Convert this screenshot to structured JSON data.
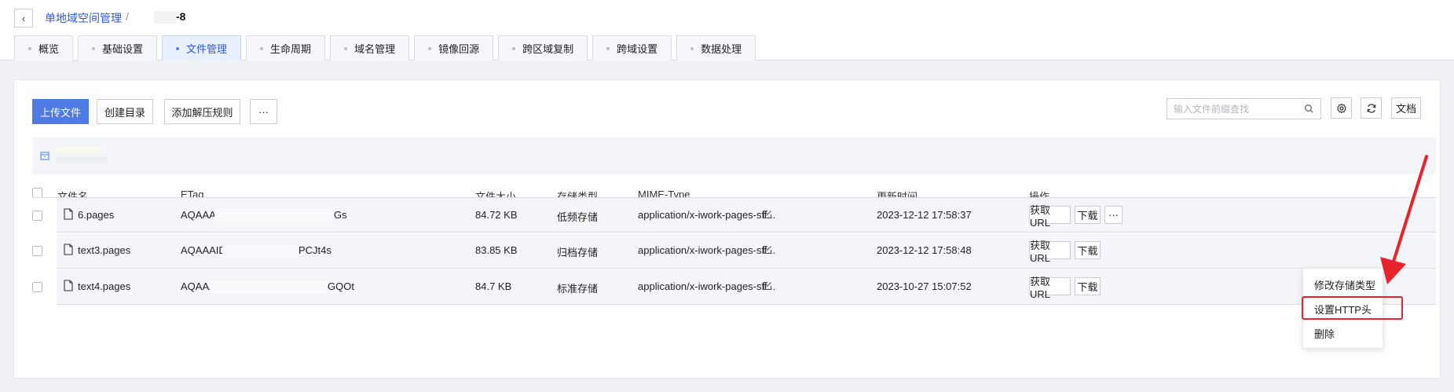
{
  "breadcrumb": {
    "parent": "单地域空间管理",
    "separator": "/",
    "current": "-8"
  },
  "tabs": [
    {
      "label": "概览",
      "active": false
    },
    {
      "label": "基础设置",
      "active": false
    },
    {
      "label": "文件管理",
      "active": true
    },
    {
      "label": "生命周期",
      "active": false
    },
    {
      "label": "域名管理",
      "active": false
    },
    {
      "label": "镜像回源",
      "active": false
    },
    {
      "label": "跨区域复制",
      "active": false
    },
    {
      "label": "跨域设置",
      "active": false
    },
    {
      "label": "数据处理",
      "active": false
    }
  ],
  "toolbar": {
    "upload": "上传文件",
    "create_dir": "创建目录",
    "add_rule": "添加解压规则",
    "more": "···",
    "search_placeholder": "输入文件前缀查找",
    "docs": "文档"
  },
  "table": {
    "headers": [
      "文件名",
      "ETag",
      "文件大小",
      "存储类型",
      "MIME-Type",
      "更新时间",
      "操作"
    ],
    "rows": [
      {
        "name": "6.pages",
        "etag_start": "AQAAAG",
        "etag_end": "Gs",
        "size": "84.72 KB",
        "storage": "低频存储",
        "mime": "application/x-iwork-pages-sff...",
        "updated": "2023-12-12 17:58:37"
      },
      {
        "name": "text3.pages",
        "etag_start": "AQAAAIDN",
        "etag_end": "PCJt4s",
        "size": "83.85 KB",
        "storage": "归档存储",
        "mime": "application/x-iwork-pages-sff...",
        "updated": "2023-12-12 17:58:48"
      },
      {
        "name": "text4.pages",
        "etag_start": "AQAAA",
        "etag_end": "GQOt",
        "size": "84.7 KB",
        "storage": "标准存储",
        "mime": "application/x-iwork-pages-sff...",
        "updated": "2023-10-27 15:07:52"
      }
    ],
    "ops": {
      "get_url": "获取URL",
      "download": "下载",
      "more": "···"
    }
  },
  "dropdown": {
    "items": [
      "修改存储类型",
      "设置HTTP头",
      "删除"
    ],
    "highlighted_index": 1
  },
  "colors": {
    "accent": "#4e7ae6",
    "annotation": "#e8232a"
  }
}
